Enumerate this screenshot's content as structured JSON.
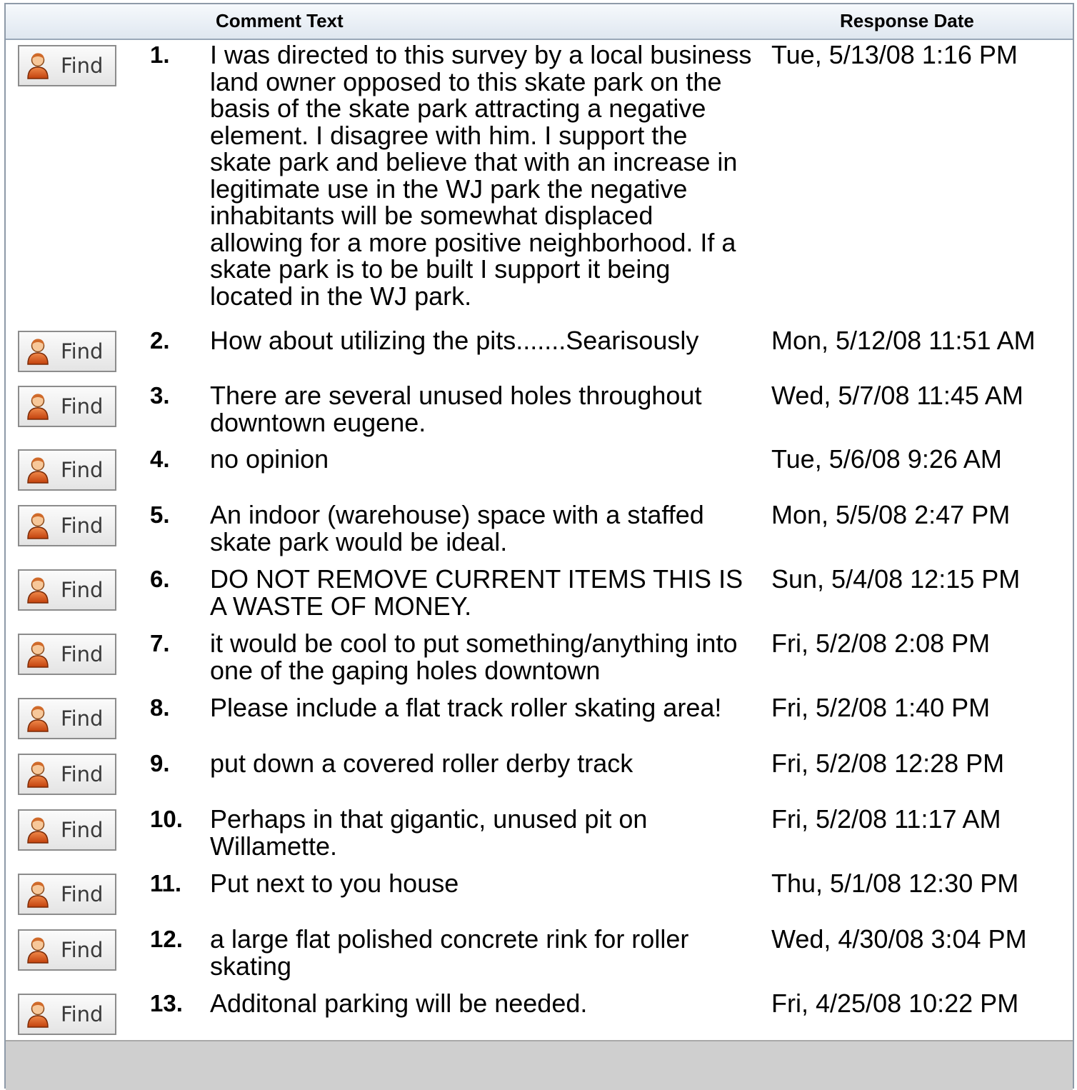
{
  "header": {
    "comment_text": "Comment Text",
    "response_date": "Response Date"
  },
  "find_label": "Find",
  "find_icon": "user-icon",
  "rows": [
    {
      "num": "1.",
      "text": "I was directed to this survey by a local business land owner opposed to this skate park on the basis of the skate park attracting a negative element. I disagree with him. I support the skate park and believe that with an increase in legitimate use in the WJ park the negative inhabitants will be somewhat displaced allowing for a more positive neighborhood. If a skate park is to be built I support it being located in the WJ park.",
      "date": "Tue, 5/13/08 1:16 PM"
    },
    {
      "num": "2.",
      "text": "How about utilizing the pits.......Searisously",
      "date": "Mon, 5/12/08 11:51 AM"
    },
    {
      "num": "3.",
      "text": "There are several unused holes throughout downtown eugene.",
      "date": "Wed, 5/7/08 11:45 AM"
    },
    {
      "num": "4.",
      "text": "no opinion",
      "date": "Tue, 5/6/08 9:26 AM"
    },
    {
      "num": "5.",
      "text": "An indoor (warehouse) space with a staffed skate park would be ideal.",
      "date": "Mon, 5/5/08 2:47 PM"
    },
    {
      "num": "6.",
      "text": "DO NOT REMOVE CURRENT ITEMS THIS IS A WASTE OF MONEY.",
      "date": "Sun, 5/4/08 12:15 PM"
    },
    {
      "num": "7.",
      "text": "it would be cool to put something/anything into one of the gaping holes downtown",
      "date": "Fri, 5/2/08 2:08 PM"
    },
    {
      "num": "8.",
      "text": "Please include a flat track roller skating area!",
      "date": "Fri, 5/2/08 1:40 PM"
    },
    {
      "num": "9.",
      "text": "put down a covered roller derby track",
      "date": "Fri, 5/2/08 12:28 PM"
    },
    {
      "num": "10.",
      "text": "Perhaps in that gigantic, unused pit on Willamette.",
      "date": "Fri, 5/2/08 11:17 AM"
    },
    {
      "num": "11.",
      "text": "Put next to you house",
      "date": "Thu, 5/1/08 12:30 PM"
    },
    {
      "num": "12.",
      "text": "a large flat polished concrete rink for roller skating",
      "date": "Wed, 4/30/08 3:04 PM"
    },
    {
      "num": "13.",
      "text": "Additonal parking will be needed.",
      "date": "Fri, 4/25/08 10:22 PM"
    }
  ]
}
